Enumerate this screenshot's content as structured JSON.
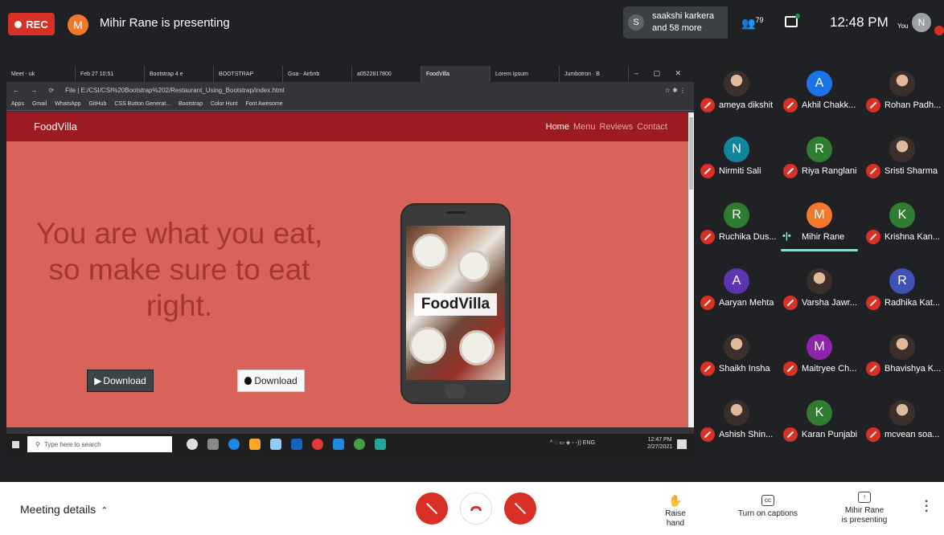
{
  "topbar": {
    "rec_label": "REC",
    "presenter_initial": "M",
    "presenter_text": "Mihir Rane is presenting",
    "notif_initial": "S",
    "notif_line1": "saakshi karkera",
    "notif_line2": "and 58 more",
    "people_count": "79",
    "time": "12:48 PM",
    "you_label": "You",
    "you_initial": "N"
  },
  "browser": {
    "tabs": [
      "Meet - uk",
      "Feb 27 10:51",
      "Bootstrap 4 e",
      "BOOTSTRAP",
      "Goa - Airbnb",
      "a0522817800",
      "FoodVilla",
      "Lorem Ipsum",
      "Jumbotron · B"
    ],
    "active_tab": 6,
    "url": "File | E:/CSI/CSI%20Bootstrap%202/Restaurant_Using_Bootstrap/index.html",
    "bookmarks": [
      "Apps",
      "Gmail",
      "WhatsApp",
      "GitHub",
      "CSS Button Generat...",
      "Bootstrap",
      "Color Hunt",
      "Font Awesome"
    ]
  },
  "site": {
    "brand": "FoodVilla",
    "menu": [
      "Home",
      "Menu",
      "Reviews",
      "Contact"
    ],
    "hero_line1": "You are what you eat,",
    "hero_line2": "so make sure to eat",
    "hero_line3": "right.",
    "download1": "Download",
    "download2": "Download",
    "phone_logo": "FoodVilla",
    "colors": {
      "navbar": "#9b1b20",
      "hero_bg": "#d9625a",
      "hero_text": "#a7372b"
    }
  },
  "taskbar": {
    "search_placeholder": "Type here to search",
    "tray": "ENG",
    "clock_time": "12:47 PM",
    "clock_date": "2/27/2021",
    "notif_count": "23"
  },
  "participants": [
    {
      "name": "ameya dikshit",
      "initial": "",
      "color": "",
      "photo": true
    },
    {
      "name": "Akhil Chakk...",
      "initial": "A",
      "color": "#1a73e8",
      "photo": false
    },
    {
      "name": "Rohan Padh...",
      "initial": "",
      "color": "",
      "photo": true
    },
    {
      "name": "Nirmiti Sali",
      "initial": "N",
      "color": "#12849b",
      "photo": false
    },
    {
      "name": "Riya Ranglani",
      "initial": "R",
      "color": "#2e7d32",
      "photo": false
    },
    {
      "name": "Sristi Sharma",
      "initial": "",
      "color": "",
      "photo": true
    },
    {
      "name": "Ruchika Dus...",
      "initial": "R",
      "color": "#2e7d32",
      "photo": false
    },
    {
      "name": "Mihir Rane",
      "initial": "M",
      "color": "#f2792b",
      "photo": false,
      "speaking": true
    },
    {
      "name": "Krishna Kan...",
      "initial": "K",
      "color": "#2e7d32",
      "photo": false
    },
    {
      "name": "Aaryan Mehta",
      "initial": "A",
      "color": "#5e35b1",
      "photo": false
    },
    {
      "name": "Varsha Jawr...",
      "initial": "",
      "color": "",
      "photo": true
    },
    {
      "name": "Radhika Kat...",
      "initial": "R",
      "color": "#3f51b5",
      "photo": false
    },
    {
      "name": "Shaikh Insha",
      "initial": "",
      "color": "",
      "photo": true
    },
    {
      "name": "Maitryee Ch...",
      "initial": "M",
      "color": "#8e24aa",
      "photo": false
    },
    {
      "name": "Bhavishya K...",
      "initial": "",
      "color": "",
      "photo": true
    },
    {
      "name": "Ashish Shin...",
      "initial": "",
      "color": "",
      "photo": true
    },
    {
      "name": "Karan Punjabi",
      "initial": "K",
      "color": "#2e7d32",
      "photo": false
    },
    {
      "name": "mcvean soa...",
      "initial": "",
      "color": "",
      "photo": true
    }
  ],
  "bottom": {
    "meeting_details": "Meeting details",
    "raise_hand": "Raise hand",
    "captions": "Turn on captions",
    "presenting_line1": "Mihir Rane",
    "presenting_line2": "is presenting"
  }
}
